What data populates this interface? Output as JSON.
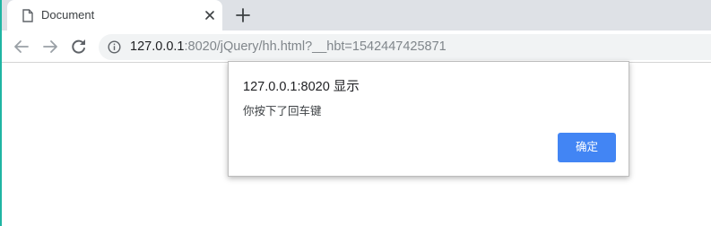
{
  "colors": {
    "tabstrip_bg": "#dee1e6",
    "omnibox_bg": "#f1f3f4",
    "accent_button": "#4285f4",
    "left_edge": "#1fb5a3"
  },
  "tab": {
    "title": "Document",
    "icon": "document-icon",
    "close_icon": "close-icon"
  },
  "new_tab_icon": "plus-icon",
  "toolbar": {
    "back_icon": "arrow-left-icon",
    "forward_icon": "arrow-right-icon",
    "reload_icon": "reload-icon",
    "info_icon": "info-icon",
    "url_host": "127.0.0.1",
    "url_rest": ":8020/jQuery/hh.html?__hbt=1542447425871"
  },
  "dialog": {
    "title": "127.0.0.1:8020 显示",
    "message": "你按下了回车键",
    "ok_label": "确定"
  }
}
